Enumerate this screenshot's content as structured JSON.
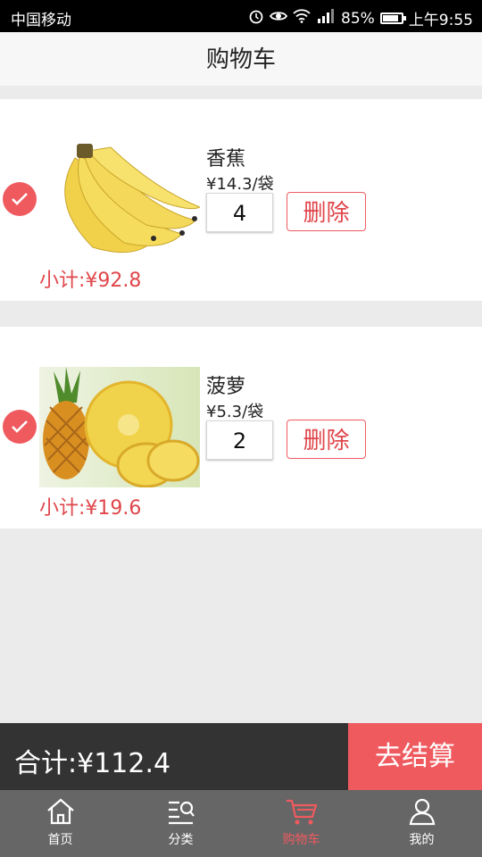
{
  "status": {
    "carrier": "中国移动",
    "battery": "85%",
    "time": "上午9:55"
  },
  "header": {
    "title": "购物车"
  },
  "items": [
    {
      "name": "香蕉",
      "price": "¥14.3/袋",
      "qty": "4",
      "delete_label": "删除",
      "subtotal": "小计:¥92.8",
      "image": "banana-image"
    },
    {
      "name": "菠萝",
      "price": "¥5.3/袋",
      "qty": "2",
      "delete_label": "删除",
      "subtotal": "小计:¥19.6",
      "image": "pineapple-image"
    }
  ],
  "footer": {
    "total": "合计:¥112.4",
    "checkout_label": "去结算"
  },
  "tabs": [
    {
      "label": "首页",
      "icon": "home-icon"
    },
    {
      "label": "分类",
      "icon": "category-icon"
    },
    {
      "label": "购物车",
      "icon": "cart-icon",
      "active": true
    },
    {
      "label": "我的",
      "icon": "user-icon"
    }
  ],
  "colors": {
    "accent": "#ef5a5f",
    "footer": "#333333",
    "tabbar": "#666666"
  }
}
